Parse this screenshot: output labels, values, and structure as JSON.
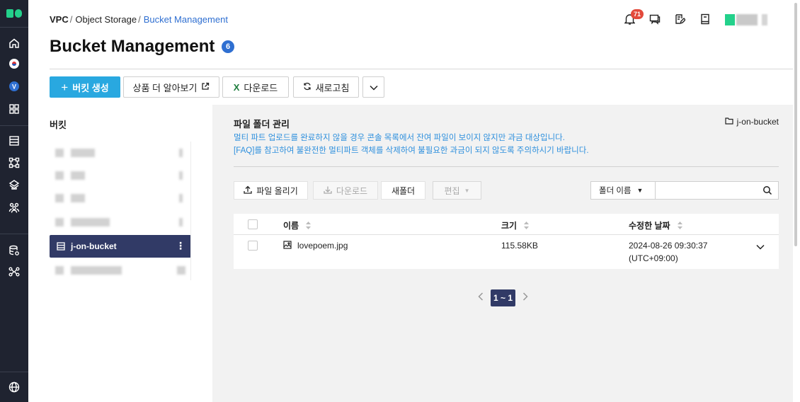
{
  "breadcrumb": {
    "items": [
      "VPC",
      "Object Storage",
      "Bucket Management"
    ]
  },
  "page": {
    "title": "Bucket Management",
    "badge": "6"
  },
  "header": {
    "notification_count": "71"
  },
  "toolbar": {
    "create_label": "버킷 생성",
    "learn_more_label": "상품 더 알아보기",
    "download_label": "다운로드",
    "refresh_label": "새로고침"
  },
  "sidebar": {
    "heading": "버킷",
    "selected_bucket": "j-on-bucket"
  },
  "main": {
    "section_title": "파일 폴더 관리",
    "notice_1": "멀티 파트 업로드를 완료하지 않을 경우 콘솔 목록에서 잔여 파일이 보이지 않지만 과금 대상입니다.",
    "notice_2": "[FAQ]를 참고하여 불완전한 멀티파트 객체를 삭제하여 불필요한 과금이 되지 않도록 주의하시기 바랍니다.",
    "bucket_path": "j-on-bucket",
    "upload_label": "파일 올리기",
    "download_label": "다운로드",
    "new_folder_label": "새폴더",
    "edit_label": "편집",
    "filter_option": "폴더 이름",
    "search_value": ""
  },
  "table": {
    "columns": [
      "이름",
      "크기",
      "수정한 날짜"
    ],
    "rows": [
      {
        "name": "lovepoem.jpg",
        "size": "115.58KB",
        "date": "2024-08-26 09:30:37",
        "tz": "(UTC+09:00)"
      }
    ]
  },
  "pagination": {
    "label": "1 ~ 1"
  },
  "colors": {
    "primary": "#29a8e0",
    "nav_bg": "#1f2330",
    "selected": "#313a66",
    "link": "#2f6fd1",
    "badge_red": "#e34a3b"
  }
}
